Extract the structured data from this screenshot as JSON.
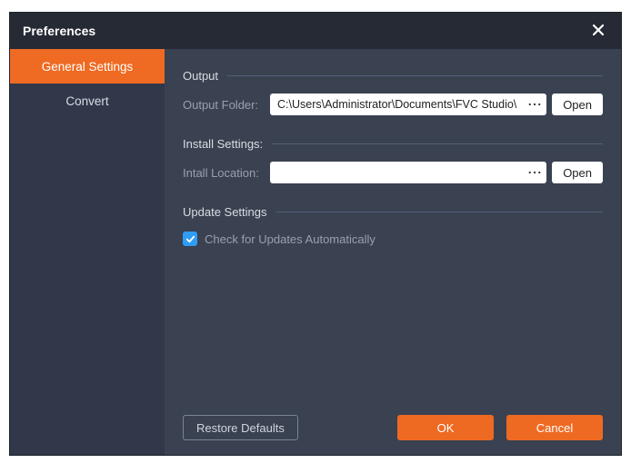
{
  "window": {
    "title": "Preferences"
  },
  "sidebar": {
    "items": [
      {
        "label": "General Settings",
        "active": true
      },
      {
        "label": "Convert",
        "active": false
      }
    ]
  },
  "sections": {
    "output": {
      "header": "Output",
      "folder_label": "Output Folder:",
      "folder_value": "C:\\Users\\Administrator\\Documents\\FVC Studio\\",
      "browse_icon": "ellipsis-icon",
      "open_label": "Open"
    },
    "install": {
      "header": "Install Settings:",
      "location_label": "Intall Location:",
      "location_value": "",
      "browse_icon": "ellipsis-icon",
      "open_label": "Open"
    },
    "update": {
      "header": "Update Settings",
      "auto_check_label": "Check for Updates Automatically",
      "auto_check_checked": true
    }
  },
  "footer": {
    "restore_label": "Restore Defaults",
    "ok_label": "OK",
    "cancel_label": "Cancel"
  },
  "colors": {
    "accent": "#ef6a22",
    "surface": "#3a4150",
    "titlebar": "#252a35",
    "sidebar": "#30384a",
    "checkbox": "#2f9df4"
  }
}
